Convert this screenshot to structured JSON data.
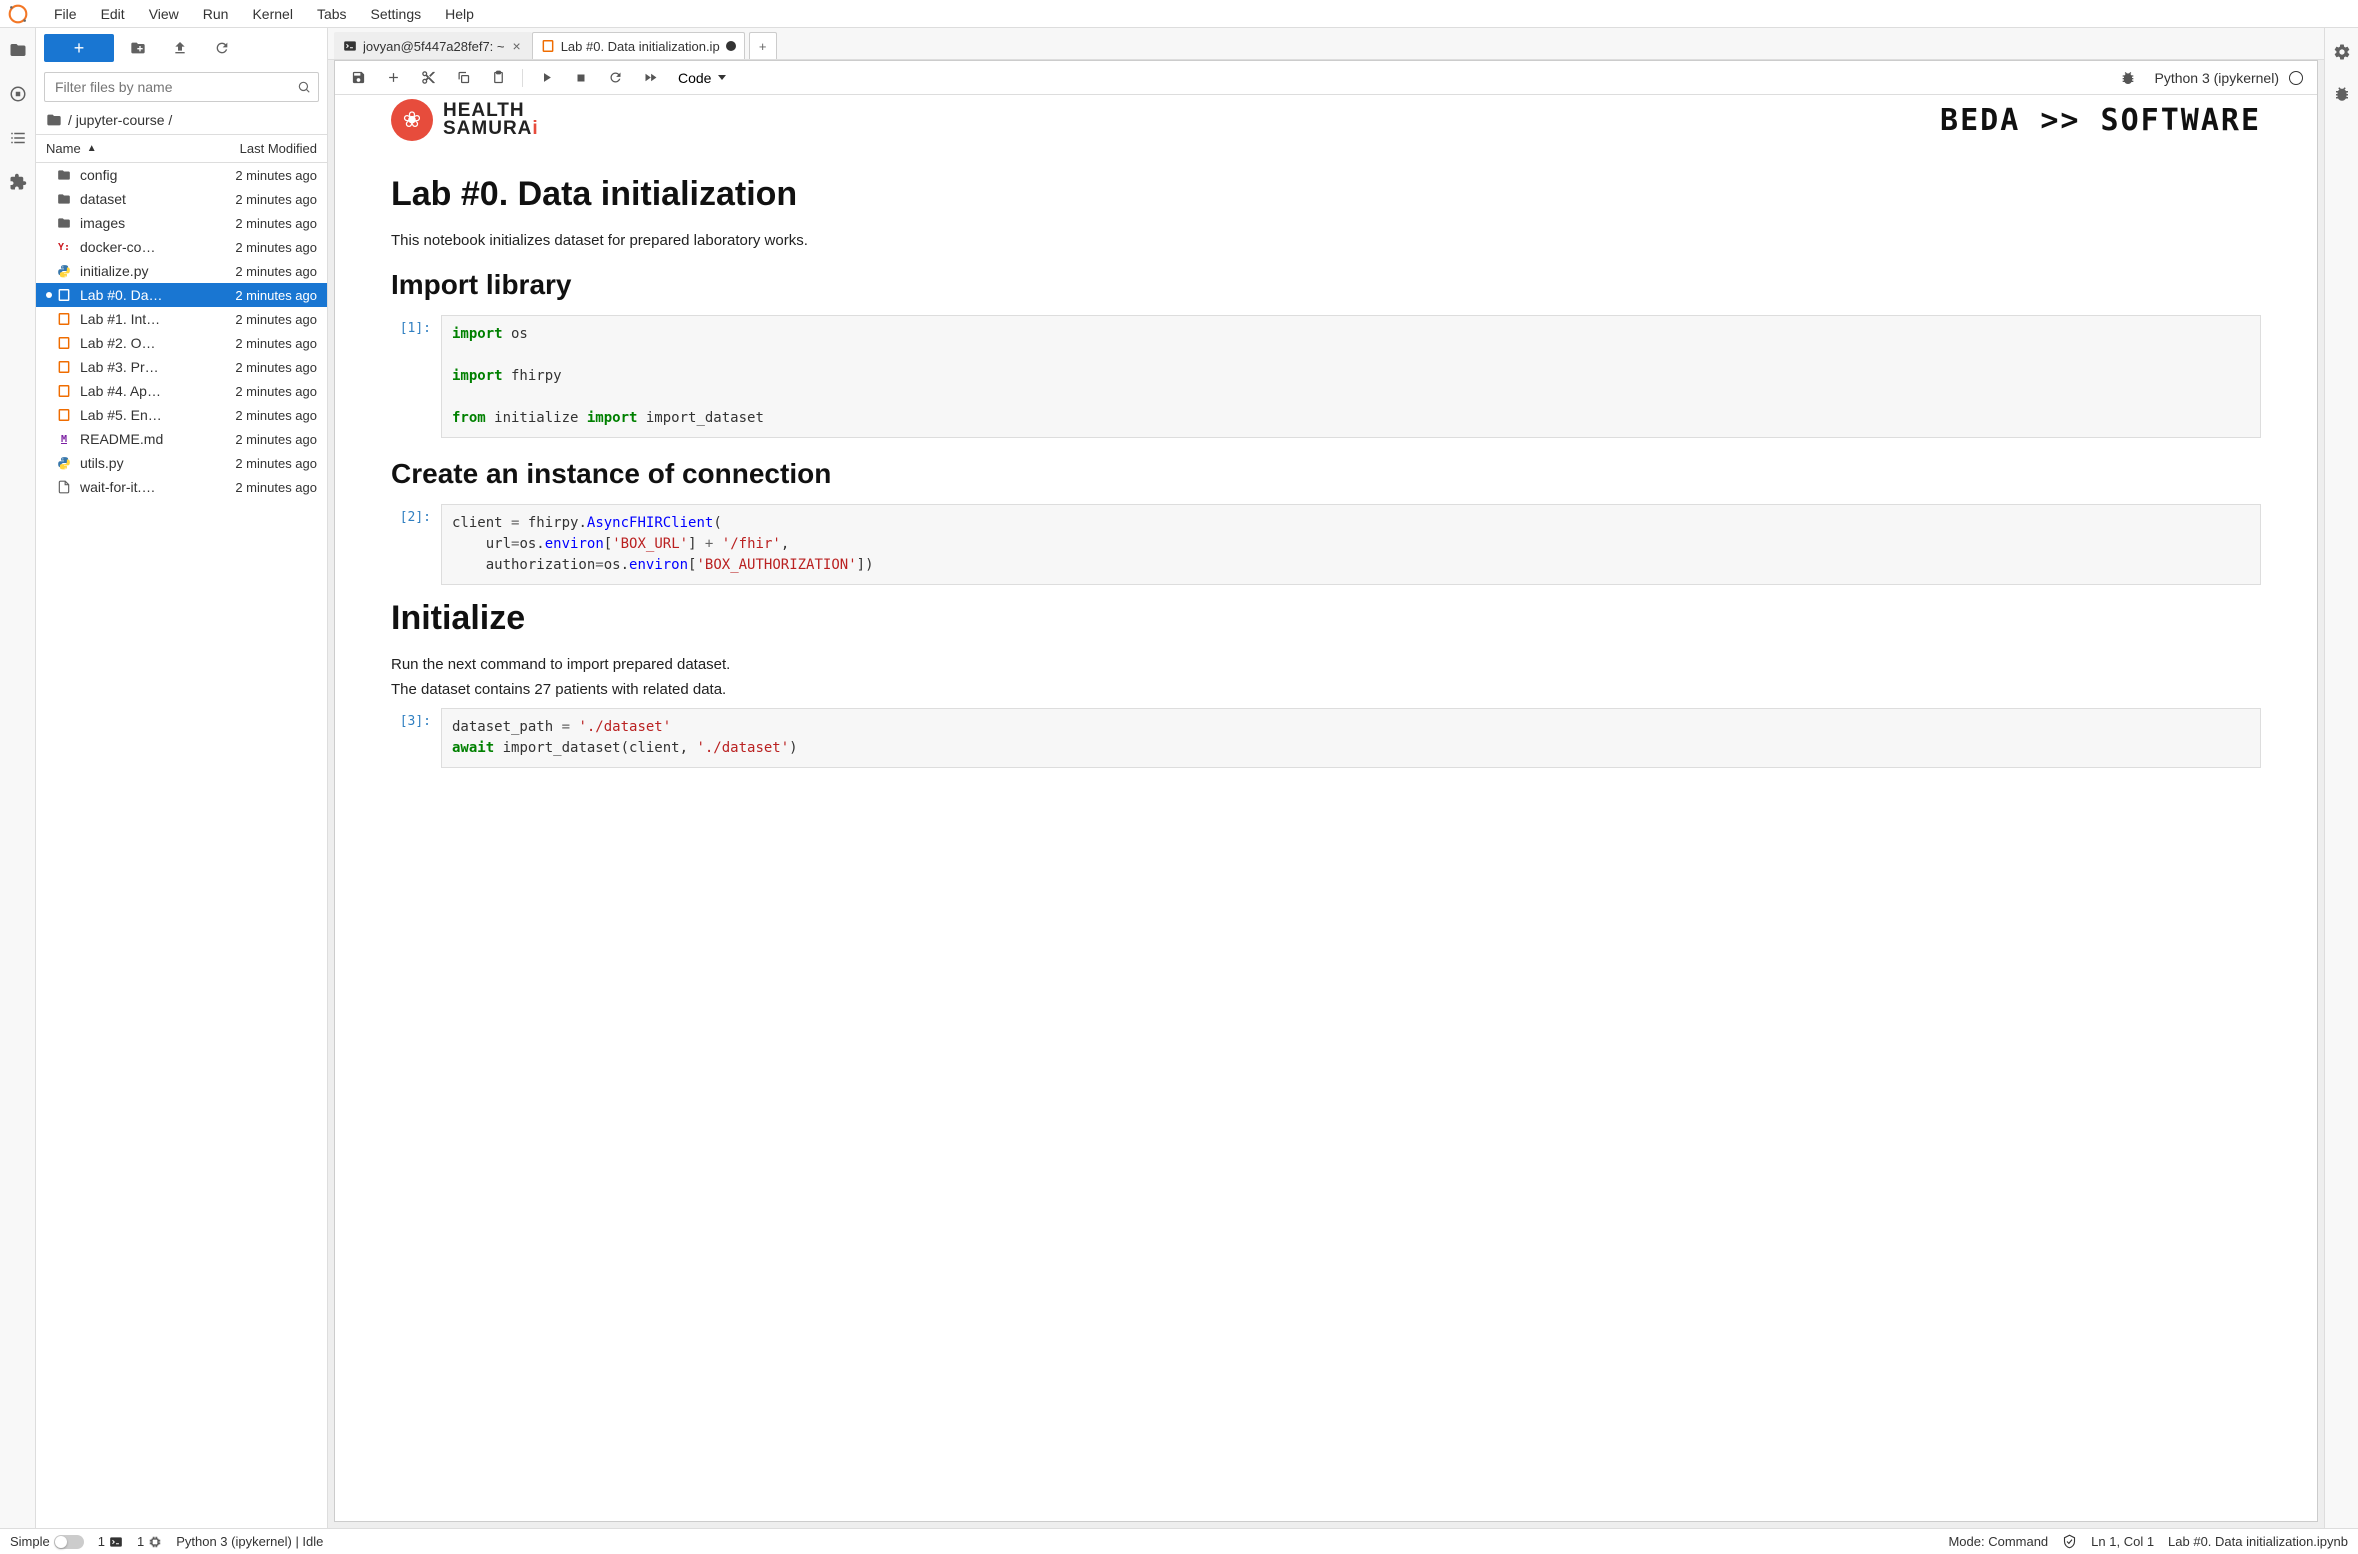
{
  "menu": [
    "File",
    "Edit",
    "View",
    "Run",
    "Kernel",
    "Tabs",
    "Settings",
    "Help"
  ],
  "sidebar": {
    "filter_placeholder": "Filter files by name",
    "breadcrumb": "/ jupyter-course /",
    "columns": {
      "name": "Name",
      "modified": "Last Modified"
    },
    "files": [
      {
        "icon": "folder",
        "name": "config",
        "modified": "2 minutes ago"
      },
      {
        "icon": "folder",
        "name": "dataset",
        "modified": "2 minutes ago"
      },
      {
        "icon": "folder",
        "name": "images",
        "modified": "2 minutes ago"
      },
      {
        "icon": "yaml",
        "name": "docker-co…",
        "modified": "2 minutes ago"
      },
      {
        "icon": "python",
        "name": "initialize.py",
        "modified": "2 minutes ago"
      },
      {
        "icon": "notebook",
        "name": "Lab #0. Da…",
        "modified": "2 minutes ago",
        "selected": true,
        "dirty": true
      },
      {
        "icon": "notebook",
        "name": "Lab #1. Int…",
        "modified": "2 minutes ago"
      },
      {
        "icon": "notebook",
        "name": "Lab #2. O…",
        "modified": "2 minutes ago"
      },
      {
        "icon": "notebook",
        "name": "Lab #3. Pr…",
        "modified": "2 minutes ago"
      },
      {
        "icon": "notebook",
        "name": "Lab #4. Ap…",
        "modified": "2 minutes ago"
      },
      {
        "icon": "notebook",
        "name": "Lab #5. En…",
        "modified": "2 minutes ago"
      },
      {
        "icon": "md",
        "name": "README.md",
        "modified": "2 minutes ago"
      },
      {
        "icon": "python",
        "name": "utils.py",
        "modified": "2 minutes ago"
      },
      {
        "icon": "generic",
        "name": "wait-for-it.…",
        "modified": "2 minutes ago"
      }
    ]
  },
  "tabs": [
    {
      "icon": "terminal",
      "label": "jovyan@5f447a28fef7: ~",
      "active": false,
      "closable": true
    },
    {
      "icon": "notebook",
      "label": "Lab #0. Data initialization.ip",
      "active": true,
      "dirty": true
    }
  ],
  "toolbar": {
    "cell_type": "Code",
    "kernel_name": "Python 3 (ipykernel)"
  },
  "banner": {
    "hs_line1": "HEALTH",
    "hs_line2": "SAMURA",
    "beda": "BEDA >> SOFTWARE"
  },
  "notebook": {
    "h1_0": "Lab #0. Data initialization",
    "p_0": "This notebook initializes dataset for prepared laboratory works.",
    "h2_0": "Import library",
    "cell1_prompt": "[1]:",
    "h2_1": "Create an instance of connection",
    "cell2_prompt": "[2]:",
    "h1_1": "Initialize",
    "p_1": "Run the next command to import prepared dataset.",
    "p_2": "The dataset contains 27 patients with related data.",
    "cell3_prompt": "[3]:"
  },
  "status": {
    "simple": "Simple",
    "count1": "1",
    "count2": "1",
    "kernel": "Python 3 (ipykernel) | Idle",
    "mode": "Mode: Command",
    "ln": "Ln 1, Col 1",
    "file": "Lab #0. Data initialization.ipynb"
  }
}
